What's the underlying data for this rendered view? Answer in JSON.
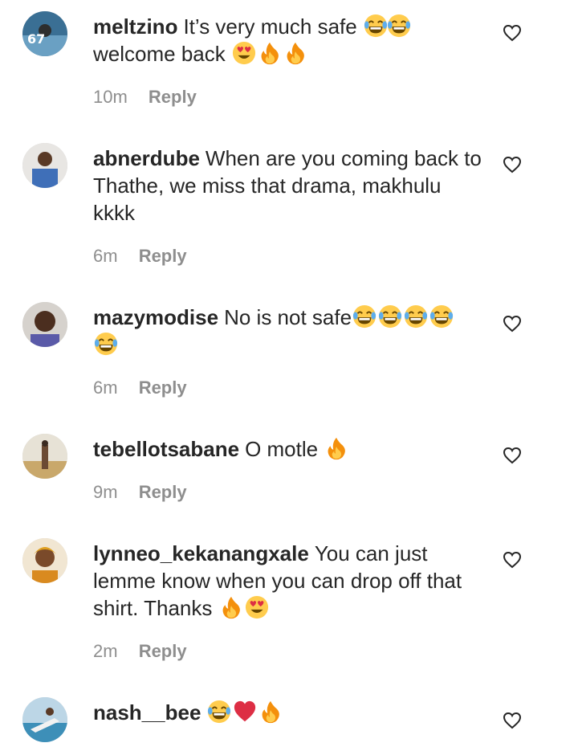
{
  "comments": [
    {
      "username": "meltzino",
      "text_before": "It’s very much safe",
      "emoji_inline": [
        "laugh",
        "laugh"
      ],
      "text_line2": "welcome back",
      "emoji_line2": [
        "heart-eyes",
        "fire",
        "fire"
      ],
      "time": "10m",
      "reply": "Reply"
    },
    {
      "username": "abnerdube",
      "text": "When are you coming back to Thathe, we miss that drama, makhulu kkkk",
      "time": "6m",
      "reply": "Reply"
    },
    {
      "username": "mazymodise",
      "text": "No is not safe",
      "emoji": [
        "laugh",
        "laugh",
        "laugh",
        "laugh",
        "laugh"
      ],
      "time": "6m",
      "reply": "Reply"
    },
    {
      "username": "tebellotsabane",
      "text": "O motle",
      "emoji": [
        "fire"
      ],
      "time": "9m",
      "reply": "Reply"
    },
    {
      "username": "lynneo_kekanangxale",
      "text": "You can just lemme know when you can drop off that shirt. Thanks",
      "emoji": [
        "fire",
        "heart-eyes"
      ],
      "time": "2m",
      "reply": "Reply"
    },
    {
      "username": "nash__bee",
      "text": "",
      "emoji": [
        "laugh",
        "red-heart",
        "fire"
      ],
      "time": "",
      "reply": ""
    }
  ],
  "colors": {
    "text": "#262626",
    "muted": "#8e8e8e",
    "background": "#ffffff"
  },
  "icons": {
    "like": "heart-outline-icon",
    "laugh": "face-with-tears-of-joy",
    "heart-eyes": "smiling-face-with-heart-eyes",
    "fire": "fire",
    "red-heart": "red-heart"
  }
}
